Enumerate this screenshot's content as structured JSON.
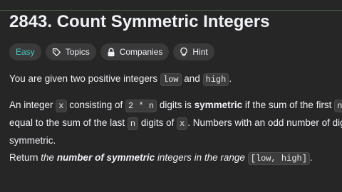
{
  "problem": {
    "title": "2843. Count Symmetric Integers"
  },
  "tags": [
    {
      "label": "Easy",
      "icon": "none"
    },
    {
      "label": "Topics",
      "icon": "tag-icon"
    },
    {
      "label": "Companies",
      "icon": "lock-icon"
    },
    {
      "label": "Hint",
      "icon": "lightbulb-icon"
    }
  ],
  "description": {
    "p1": {
      "t1": "You are given two positive integers ",
      "c1": "low",
      "t2": " and ",
      "c2": "high",
      "t3": "."
    },
    "p2": {
      "t1": "An integer ",
      "c1": "x",
      "t2": " consisting of ",
      "c2": "2 * n",
      "t3": " digits is ",
      "b1": "symmetric",
      "t4": " if the sum of the first ",
      "c3": "n",
      "l2_t1": "equal to the sum of the last ",
      "l2_c1": "n",
      "l2_t2": " digits of ",
      "l2_c2": "x",
      "l2_t3": ". Numbers with an odd number of dig",
      "l3_t1": "symmetric."
    },
    "p3": {
      "t1": "Return ",
      "i1": "the ",
      "bi": "number of symmetric",
      "i2": " integers in the range ",
      "c1": "[low, high]",
      "t2": "."
    }
  },
  "colors": {
    "background": "#262626",
    "easy": "#46c6c2",
    "text": "#eff1f6"
  }
}
